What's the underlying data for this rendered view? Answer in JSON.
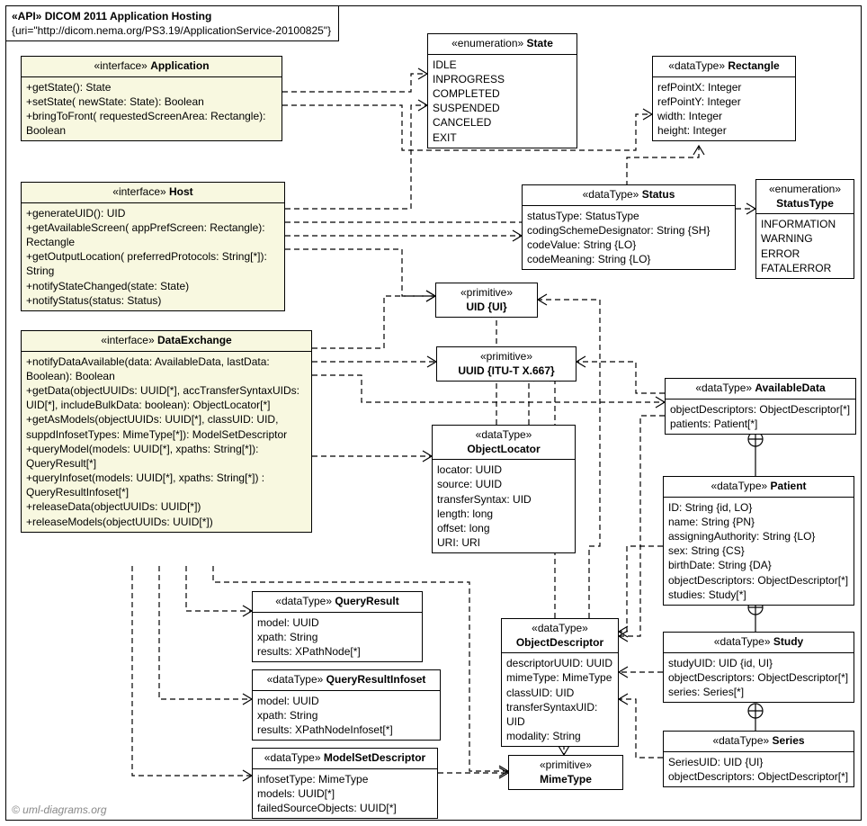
{
  "frame": {
    "stereo": "«API»",
    "title": "DICOM 2011 Application Hosting",
    "uri": "{uri=\"http://dicom.nema.org/PS3.19/ApplicationService-20100825\"}"
  },
  "copyright": "© uml-diagrams.org",
  "classes": {
    "Application": {
      "stereo": "«interface»",
      "name": "Application",
      "members": "+getState(): State\n+setState( newState: State): Boolean\n+bringToFront( requestedScreenArea: Rectangle): Boolean"
    },
    "Host": {
      "stereo": "«interface»",
      "name": "Host",
      "members": "+generateUID(): UID\n+getAvailableScreen( appPrefScreen: Rectangle): Rectangle\n+getOutputLocation( preferredProtocols: String[*]): String\n+notifyStateChanged(state: State)\n+notifyStatus(status: Status)"
    },
    "DataExchange": {
      "stereo": "«interface»",
      "name": "DataExchange",
      "members": "+notifyDataAvailable(data: AvailableData, lastData: Boolean): Boolean\n+getData(objectUUIDs: UUID[*], accTransferSyntaxUIDs: UID[*], includeBulkData: boolean): ObjectLocator[*]\n+getAsModels(objectUUIDs: UUID[*], classUID: UID, suppdInfosetTypes: MimeType[*]): ModelSetDescriptor\n+queryModel(models: UUID[*], xpaths: String[*]): QueryResult[*]\n+queryInfoset(models: UUID[*], xpaths: String[*]) : QueryResultInfoset[*]\n+releaseData(objectUUIDs: UUID[*])\n+releaseModels(objectUUIDs: UUID[*])"
    },
    "State": {
      "stereo": "«enumeration»",
      "name": "State",
      "members": "IDLE\nINPROGRESS\nCOMPLETED\nSUSPENDED\nCANCELED\nEXIT"
    },
    "Rectangle": {
      "stereo": "«dataType»",
      "name": "Rectangle",
      "members": "refPointX: Integer\nrefPointY: Integer\nwidth: Integer\nheight: Integer"
    },
    "Status": {
      "stereo": "«dataType»",
      "name": "Status",
      "members": "statusType: StatusType\ncodingSchemeDesignator: String {SH}\ncodeValue: String {LO}\ncodeMeaning: String {LO}"
    },
    "StatusType": {
      "stereo": "«enumeration»",
      "name": "StatusType",
      "members": "INFORMATION\nWARNING\nERROR\nFATALERROR"
    },
    "UID": {
      "stereo": "«primitive»",
      "name": "UID {UI}"
    },
    "UUID": {
      "stereo": "«primitive»",
      "name": "UUID {ITU-T X.667}"
    },
    "ObjectLocator": {
      "stereo": "«dataType»",
      "name": "ObjectLocator",
      "members": "locator: UUID\nsource: UUID\ntransferSyntax: UID\nlength: long\noffset: long\nURI: URI"
    },
    "AvailableData": {
      "stereo": "«dataType»",
      "name": "AvailableData",
      "members": "objectDescriptors: ObjectDescriptor[*]\npatients: Patient[*]"
    },
    "ObjectDescriptor": {
      "stereo": "«dataType»",
      "name": "ObjectDescriptor",
      "members": "descriptorUUID: UUID\nmimeType: MimeType\nclassUID: UID\ntransferSyntaxUID: UID\nmodality: String"
    },
    "Patient": {
      "stereo": "«dataType»",
      "name": "Patient",
      "members": "ID: String {id, LO}\nname: String {PN}\nassigningAuthority: String {LO}\nsex: String {CS}\nbirthDate: String {DA}\nobjectDescriptors: ObjectDescriptor[*]\nstudies: Study[*]"
    },
    "Study": {
      "stereo": "«dataType»",
      "name": "Study",
      "members": "studyUID: UID {id, UI}\nobjectDescriptors: ObjectDescriptor[*]\nseries: Series[*]"
    },
    "Series": {
      "stereo": "«dataType»",
      "name": "Series",
      "members": "SeriesUID: UID {UI}\nobjectDescriptors: ObjectDescriptor[*]"
    },
    "QueryResult": {
      "stereo": "«dataType»",
      "name": "QueryResult",
      "members": "model: UUID\nxpath: String\nresults: XPathNode[*]"
    },
    "QueryResultInfoset": {
      "stereo": "«dataType»",
      "name": "QueryResultInfoset",
      "members": "model: UUID\nxpath: String\nresults: XPathNodeInfoset[*]"
    },
    "ModelSetDescriptor": {
      "stereo": "«dataType»",
      "name": "ModelSetDescriptor",
      "members": "infosetType: MimeType\nmodels: UUID[*]\nfailedSourceObjects: UUID[*]"
    },
    "MimeType": {
      "stereo": "«primitive»",
      "name": "MimeType"
    }
  }
}
